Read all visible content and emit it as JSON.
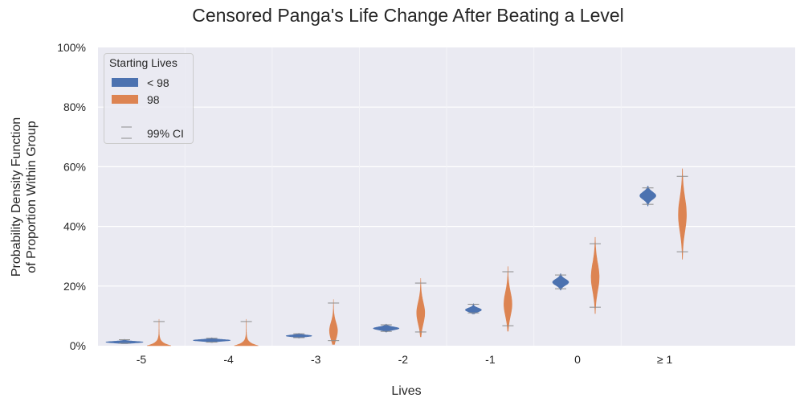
{
  "chart_data": {
    "type": "violin",
    "title": "Censored Panga's Life Change After Beating a Level",
    "xlabel": "Lives",
    "ylabel_lines": [
      "Probability Density Function",
      "of Proportion Within Group"
    ],
    "categories": [
      "-5",
      "-4",
      "-3",
      "-2",
      "-1",
      "0",
      "≥ 1"
    ],
    "yticks": [
      "0%",
      "20%",
      "40%",
      "60%",
      "80%",
      "100%"
    ],
    "ylim": [
      0,
      100
    ],
    "grid": true,
    "legend": {
      "title": "Starting Lives",
      "placement": "top-left",
      "entries": [
        {
          "label": "< 98",
          "color": "#4c72b0"
        },
        {
          "label": "98",
          "color": "#dd8452"
        },
        {
          "label": "99% CI",
          "color": "#8c8c8c"
        }
      ]
    },
    "series": [
      {
        "name": "< 98",
        "color": "#4c72b0",
        "mode": [
          1.2,
          1.8,
          3.3,
          5.8,
          12.0,
          21.3,
          50.3
        ],
        "ci_low": [
          0.8,
          1.2,
          2.7,
          4.8,
          11.0,
          19.1,
          47.4
        ],
        "ci_high": [
          2.0,
          2.5,
          4.0,
          7.0,
          13.9,
          23.7,
          52.9
        ]
      },
      {
        "name": "98",
        "color": "#dd8452",
        "mode": [
          0.3,
          0.3,
          5.0,
          11.0,
          14.0,
          23.0,
          44.0
        ],
        "ci_low": [
          0.0,
          0.0,
          1.7,
          4.6,
          6.7,
          12.9,
          31.5
        ],
        "ci_high": [
          8.1,
          8.1,
          14.3,
          21.0,
          24.8,
          34.2,
          56.8
        ]
      }
    ]
  }
}
